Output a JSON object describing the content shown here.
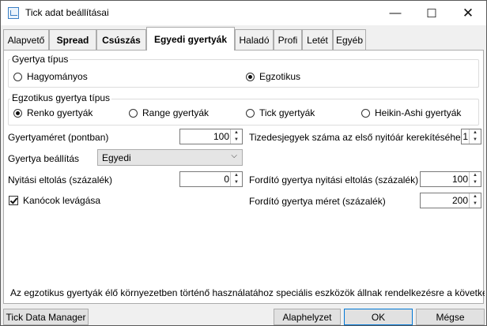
{
  "window": {
    "title": "Tick adat beállításai",
    "minimize_icon": "minimize-icon",
    "maximize_icon": "maximize-icon",
    "close_icon": "close-icon"
  },
  "tabs": [
    {
      "label": "Alapvető"
    },
    {
      "label": "Spread"
    },
    {
      "label": "Csúszás"
    },
    {
      "label": "Egyedi gyertyák",
      "active": true
    },
    {
      "label": "Haladó"
    },
    {
      "label": "Profi"
    },
    {
      "label": "Letét"
    },
    {
      "label": "Egyéb"
    }
  ],
  "candle_type": {
    "legend": "Gyertya típus",
    "options": [
      {
        "label": "Hagyományos",
        "selected": false
      },
      {
        "label": "Egzotikus",
        "selected": true
      }
    ]
  },
  "exotic_type": {
    "legend": "Egzotikus gyertya típus",
    "options": [
      {
        "label": "Renko gyertyák",
        "selected": true
      },
      {
        "label": "Range gyertyák",
        "selected": false
      },
      {
        "label": "Tick gyertyák",
        "selected": false
      },
      {
        "label": "Heikin-Ashi gyertyák",
        "selected": false
      }
    ]
  },
  "fields": {
    "candle_size": {
      "label": "Gyertyaméret (pontban)",
      "value": "100"
    },
    "decimals": {
      "label": "Tizedesjegyek száma az első nyitóár kerekítéséhez",
      "value": "1"
    },
    "candle_setting": {
      "label": "Gyertya beállítás",
      "value": "Egyedi"
    },
    "open_offset": {
      "label": "Nyitási eltolás (százalék)",
      "value": "0"
    },
    "reverse_open_offset": {
      "label": "Fordító gyertya nyitási eltolás (százalék)",
      "value": "100"
    },
    "wick_cut": {
      "label": "Kanócok levágása",
      "checked": true
    },
    "reverse_size": {
      "label": "Fordító gyertya méret (százalék)",
      "value": "200"
    }
  },
  "info_text": "Az egzotikus gyertyák élő környezetben történő használatához speciális eszközök állnak rendelkezésre a következ",
  "buttons": {
    "manager": "Tick Data Manager",
    "default": "Alaphelyzet",
    "ok": "OK",
    "cancel": "Mégse"
  },
  "colors": {
    "accent": "#0078d7",
    "window_bg": "#f0f0f0",
    "panel_bg": "#ffffff"
  }
}
